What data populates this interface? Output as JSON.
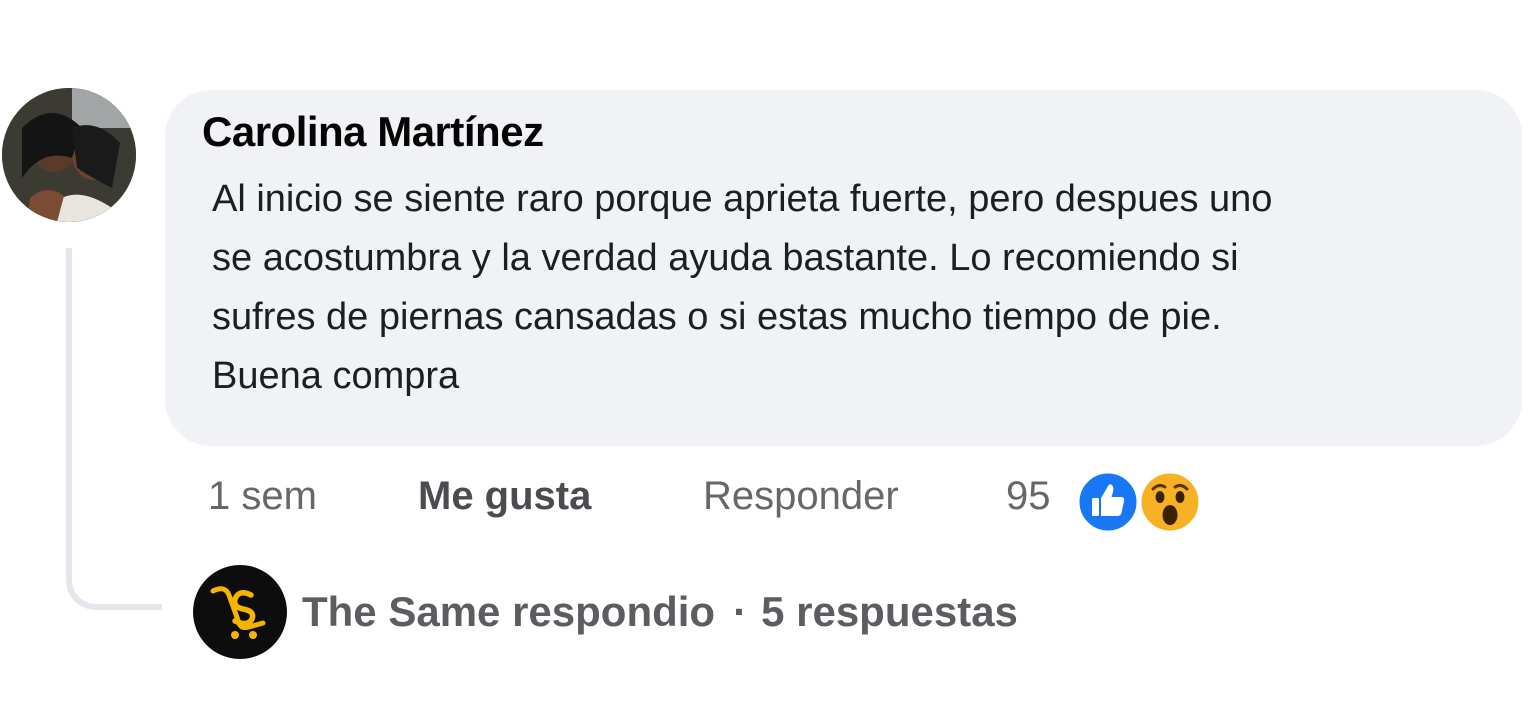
{
  "comment": {
    "author": "Carolina Martínez",
    "avatar_icon": "profile-photo",
    "text": "Al inicio se siente raro porque aprieta fuerte, pero despues uno\nse acostumbra y la verdad ayuda bastante. Lo recomiendo si\nsufres de piernas cansadas o si estas mucho tiempo de pie.\nBuena compra",
    "time": "1 sem",
    "like_label": "Me gusta",
    "reply_label": "Responder",
    "reaction_count": "95",
    "reactions": [
      "like-icon",
      "wow-icon"
    ]
  },
  "replies": {
    "avatar_icon": "the-same-logo",
    "author_text": "The Same respondio",
    "separator": "·",
    "count_text": "5 respuestas"
  },
  "colors": {
    "bubble": "#f0f2f5",
    "like_blue": "#1877f2",
    "wow_yellow": "#f7b125",
    "muted_text": "#65676b",
    "logo_gold": "#f5b400"
  }
}
